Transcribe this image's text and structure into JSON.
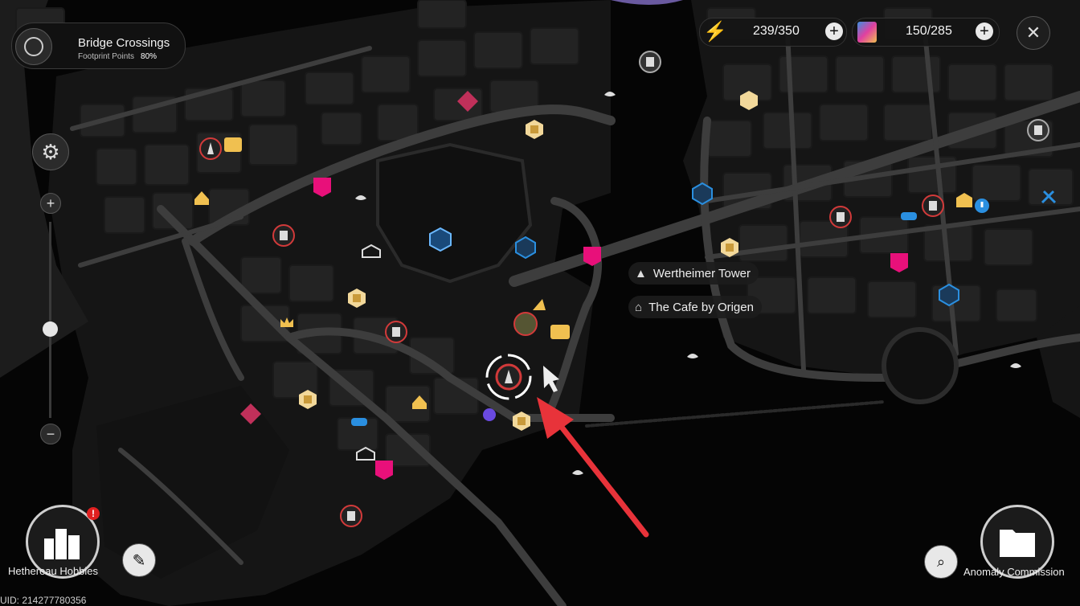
{
  "area": {
    "title": "Bridge Crossings",
    "subtitle": "Footprint Points",
    "percent": "80%"
  },
  "currency": [
    {
      "value": "239/350",
      "icon": "energy-icon"
    },
    {
      "value": "150/285",
      "icon": "card-icon"
    }
  ],
  "labels": {
    "tower": "Wertheimer Tower",
    "cafe": "The Cafe by Origen"
  },
  "bottom": {
    "left_button": "Hethereau Hobbies",
    "right_button": "Anomaly Commission",
    "uid": "UID: 214277780356",
    "alert_badge": "!"
  },
  "zoom": {
    "level": 0.55
  },
  "colors": {
    "map_land": "#151515",
    "map_water": "#050505",
    "road": "#3a3a3a",
    "marker_red": "#d23a3a",
    "marker_gold": "#f0c050",
    "marker_pink": "#e8107a",
    "marker_blue": "#2a8fe0",
    "arrow": "#e8333a"
  }
}
